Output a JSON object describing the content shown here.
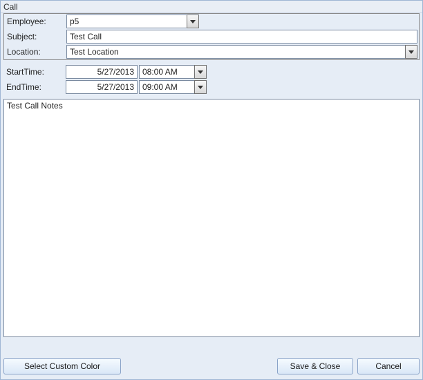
{
  "window": {
    "title": "Call"
  },
  "form": {
    "employee_label": "Employee:",
    "employee_value": "p5",
    "subject_label": "Subject:",
    "subject_value": "Test Call",
    "location_label": "Location:",
    "location_value": "Test Location"
  },
  "times": {
    "start_label": "StartTime:",
    "start_date": "5/27/2013",
    "start_time": "08:00 AM",
    "end_label": "EndTime:",
    "end_date": "5/27/2013",
    "end_time": "09:00 AM"
  },
  "notes": {
    "value": "Test Call Notes"
  },
  "buttons": {
    "select_color": "Select Custom Color",
    "save_close": "Save & Close",
    "cancel": "Cancel"
  }
}
